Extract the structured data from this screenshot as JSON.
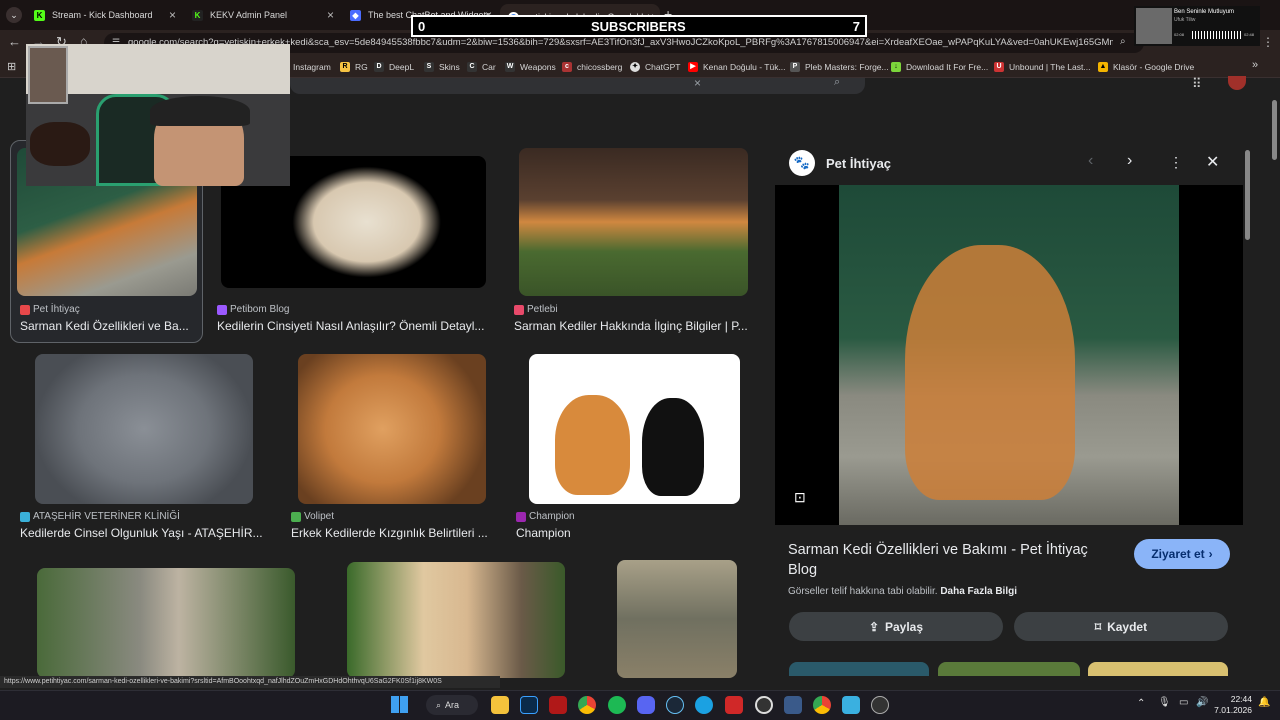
{
  "tabs": [
    {
      "label": "Stream - Kick Dashboard",
      "color": "#53fc18",
      "letter": "K"
    },
    {
      "label": "KEKV Admin Panel",
      "color": "#2a2a2a",
      "letter": "K"
    },
    {
      "label": "The best ChatBot and Widgets",
      "color": "#4b6cff",
      "letter": "◆"
    },
    {
      "label": "yetişkin erkek kedi - Google'd",
      "color": "#ffffff",
      "letter": "G"
    }
  ],
  "subscribers": {
    "left": "0",
    "label": "SUBSCRIBERS",
    "right": "7"
  },
  "music": {
    "title": "Ben Seninle Mutluyum",
    "artist": "Ufuk Tiliw",
    "time_left": "02:08",
    "time_right": "02:48"
  },
  "address": {
    "url": "google.com/search?q=yetişkin+erkek+kedi&sca_esv=5de84945538fbbc7&udm=2&biw=1536&bih=729&sxsrf=AE3TifOn3fJ_axV3HwoJCZkoKpoL_PBRFg%3A1767815006947&ei=XrdeafXEOae_wPAPqKuLYA&ved=0ahUKEwj165GMmPqRA..."
  },
  "bookmarks": [
    "Instagram",
    "RG",
    "DeepL",
    "Skins",
    "Car",
    "Weapons",
    "chicossberg",
    "ChatGPT",
    "Kenan Doğulu - Tük...",
    "Pleb Masters: Forge...",
    "Download It For Fre...",
    "Unbound | The Last...",
    "Klasör - Google Drive"
  ],
  "results": [
    {
      "source": "Pet İhtiyaç",
      "title": "Sarman Kedi Özellikleri ve Ba...",
      "src_color": "#e8484a"
    },
    {
      "source": "Petibom Blog",
      "title": "Kedilerin Cinsiyeti Nasıl Anlaşılır? Önemli Detayl...",
      "src_color": "#9b59ff"
    },
    {
      "source": "Petlebi",
      "title": "Sarman Kediler Hakkında İlginç Bilgiler | P...",
      "src_color": "#e84a6a"
    },
    {
      "source": "ATAŞEHİR VETERİNER KLİNİĞİ",
      "title": "Kedilerde Cinsel Olgunluk Yaşı - ATAŞEHİR...",
      "src_color": "#3ab0d8"
    },
    {
      "source": "Volipet",
      "title": "Erkek Kedilerde Kızgınlık Belirtileri ...",
      "src_color": "#4caf50"
    },
    {
      "source": "Champion",
      "title": "Champion",
      "src_color": "#9c27b0"
    }
  ],
  "panel": {
    "source": "Pet İhtiyaç",
    "title": "Sarman Kedi Özellikleri ve Bakımı - Pet İhtiyaç Blog",
    "visit": "Ziyaret et",
    "copyright": "Görseller telif hakkına tabi olabilir.",
    "more_info": "Daha Fazla Bilgi",
    "share": "Paylaş",
    "save": "Kaydet"
  },
  "status_url": "https://www.petihtiyac.com/sarman-kedi-ozellikleri-ve-bakimi?srsltid=AfmBOoohtxqd_nafJlhdZOuZmHxGDHdOhthvqU6SaG2FK0Sf1ij8KW0S",
  "taskbar": {
    "search": "Ara",
    "time": "22:44",
    "date": "7.01.2026"
  },
  "colors": {
    "accent": "#8ab4f8",
    "bg": "#1f1f1f"
  }
}
